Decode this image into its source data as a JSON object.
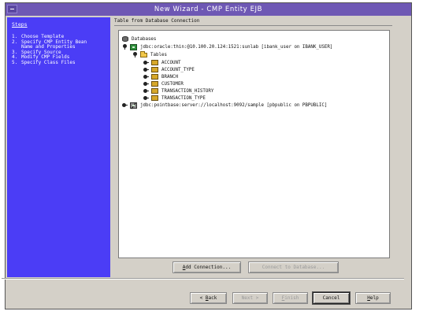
{
  "window": {
    "title": "New Wizard - CMP Entity EJB"
  },
  "steps": {
    "header": "Steps",
    "items": [
      {
        "num": "1.",
        "label": "Choose Template"
      },
      {
        "num": "2.",
        "label": "Specify CMP Entity Bean\nName and Properties"
      },
      {
        "num": "3.",
        "label": "Specify Source"
      },
      {
        "num": "4.",
        "label": "Modify CMP Fields"
      },
      {
        "num": "5.",
        "label": "Specify Class Files"
      }
    ]
  },
  "content": {
    "header": "Table from Database Connection",
    "tree": {
      "root": "Databases",
      "connection1": "jdbc:oracle:thin:@10.100.20.124:1521:sunlab [ibank_user on IBANK_USER]",
      "tables_folder": "Tables",
      "tables": [
        "ACCOUNT",
        "ACCOUNT_TYPE",
        "BRANCH",
        "CUSTOMER",
        "TRANSACTION_HISTORY",
        "TRANSACTION_TYPE"
      ],
      "connection2": "jdbc:pointbase:server://localhost:9092/sample [pbpublic on PBPUBLIC]"
    },
    "add_connection": {
      "mnemonic": "A",
      "rest": "dd Connection..."
    },
    "connect_db": "Connect to Database..."
  },
  "footer": {
    "back": {
      "prefix": "< ",
      "mnemonic": "B",
      "rest": "ack"
    },
    "next": "Next >",
    "finish": {
      "mnemonic": "F",
      "rest": "inish"
    },
    "cancel": "Cancel",
    "help": {
      "mnemonic": "H",
      "rest": "elp"
    }
  }
}
